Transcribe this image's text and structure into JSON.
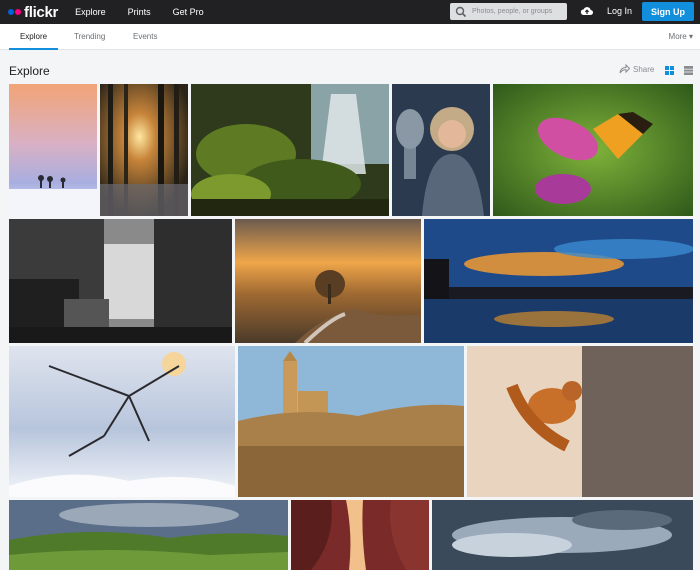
{
  "topbar": {
    "logo": "flickr",
    "nav": [
      "Explore",
      "Prints",
      "Get Pro"
    ],
    "search_placeholder": "Photos, people, or groups",
    "login": "Log In",
    "signup": "Sign Up"
  },
  "subnav": {
    "tabs": [
      "Explore",
      "Trending",
      "Events"
    ],
    "more": "More ▾"
  },
  "main": {
    "title": "Explore",
    "share": "Share"
  },
  "colors": {
    "accent": "#128fdc",
    "topbar": "#212124",
    "brand_blue": "#0063dc",
    "brand_pink": "#ff0084"
  }
}
